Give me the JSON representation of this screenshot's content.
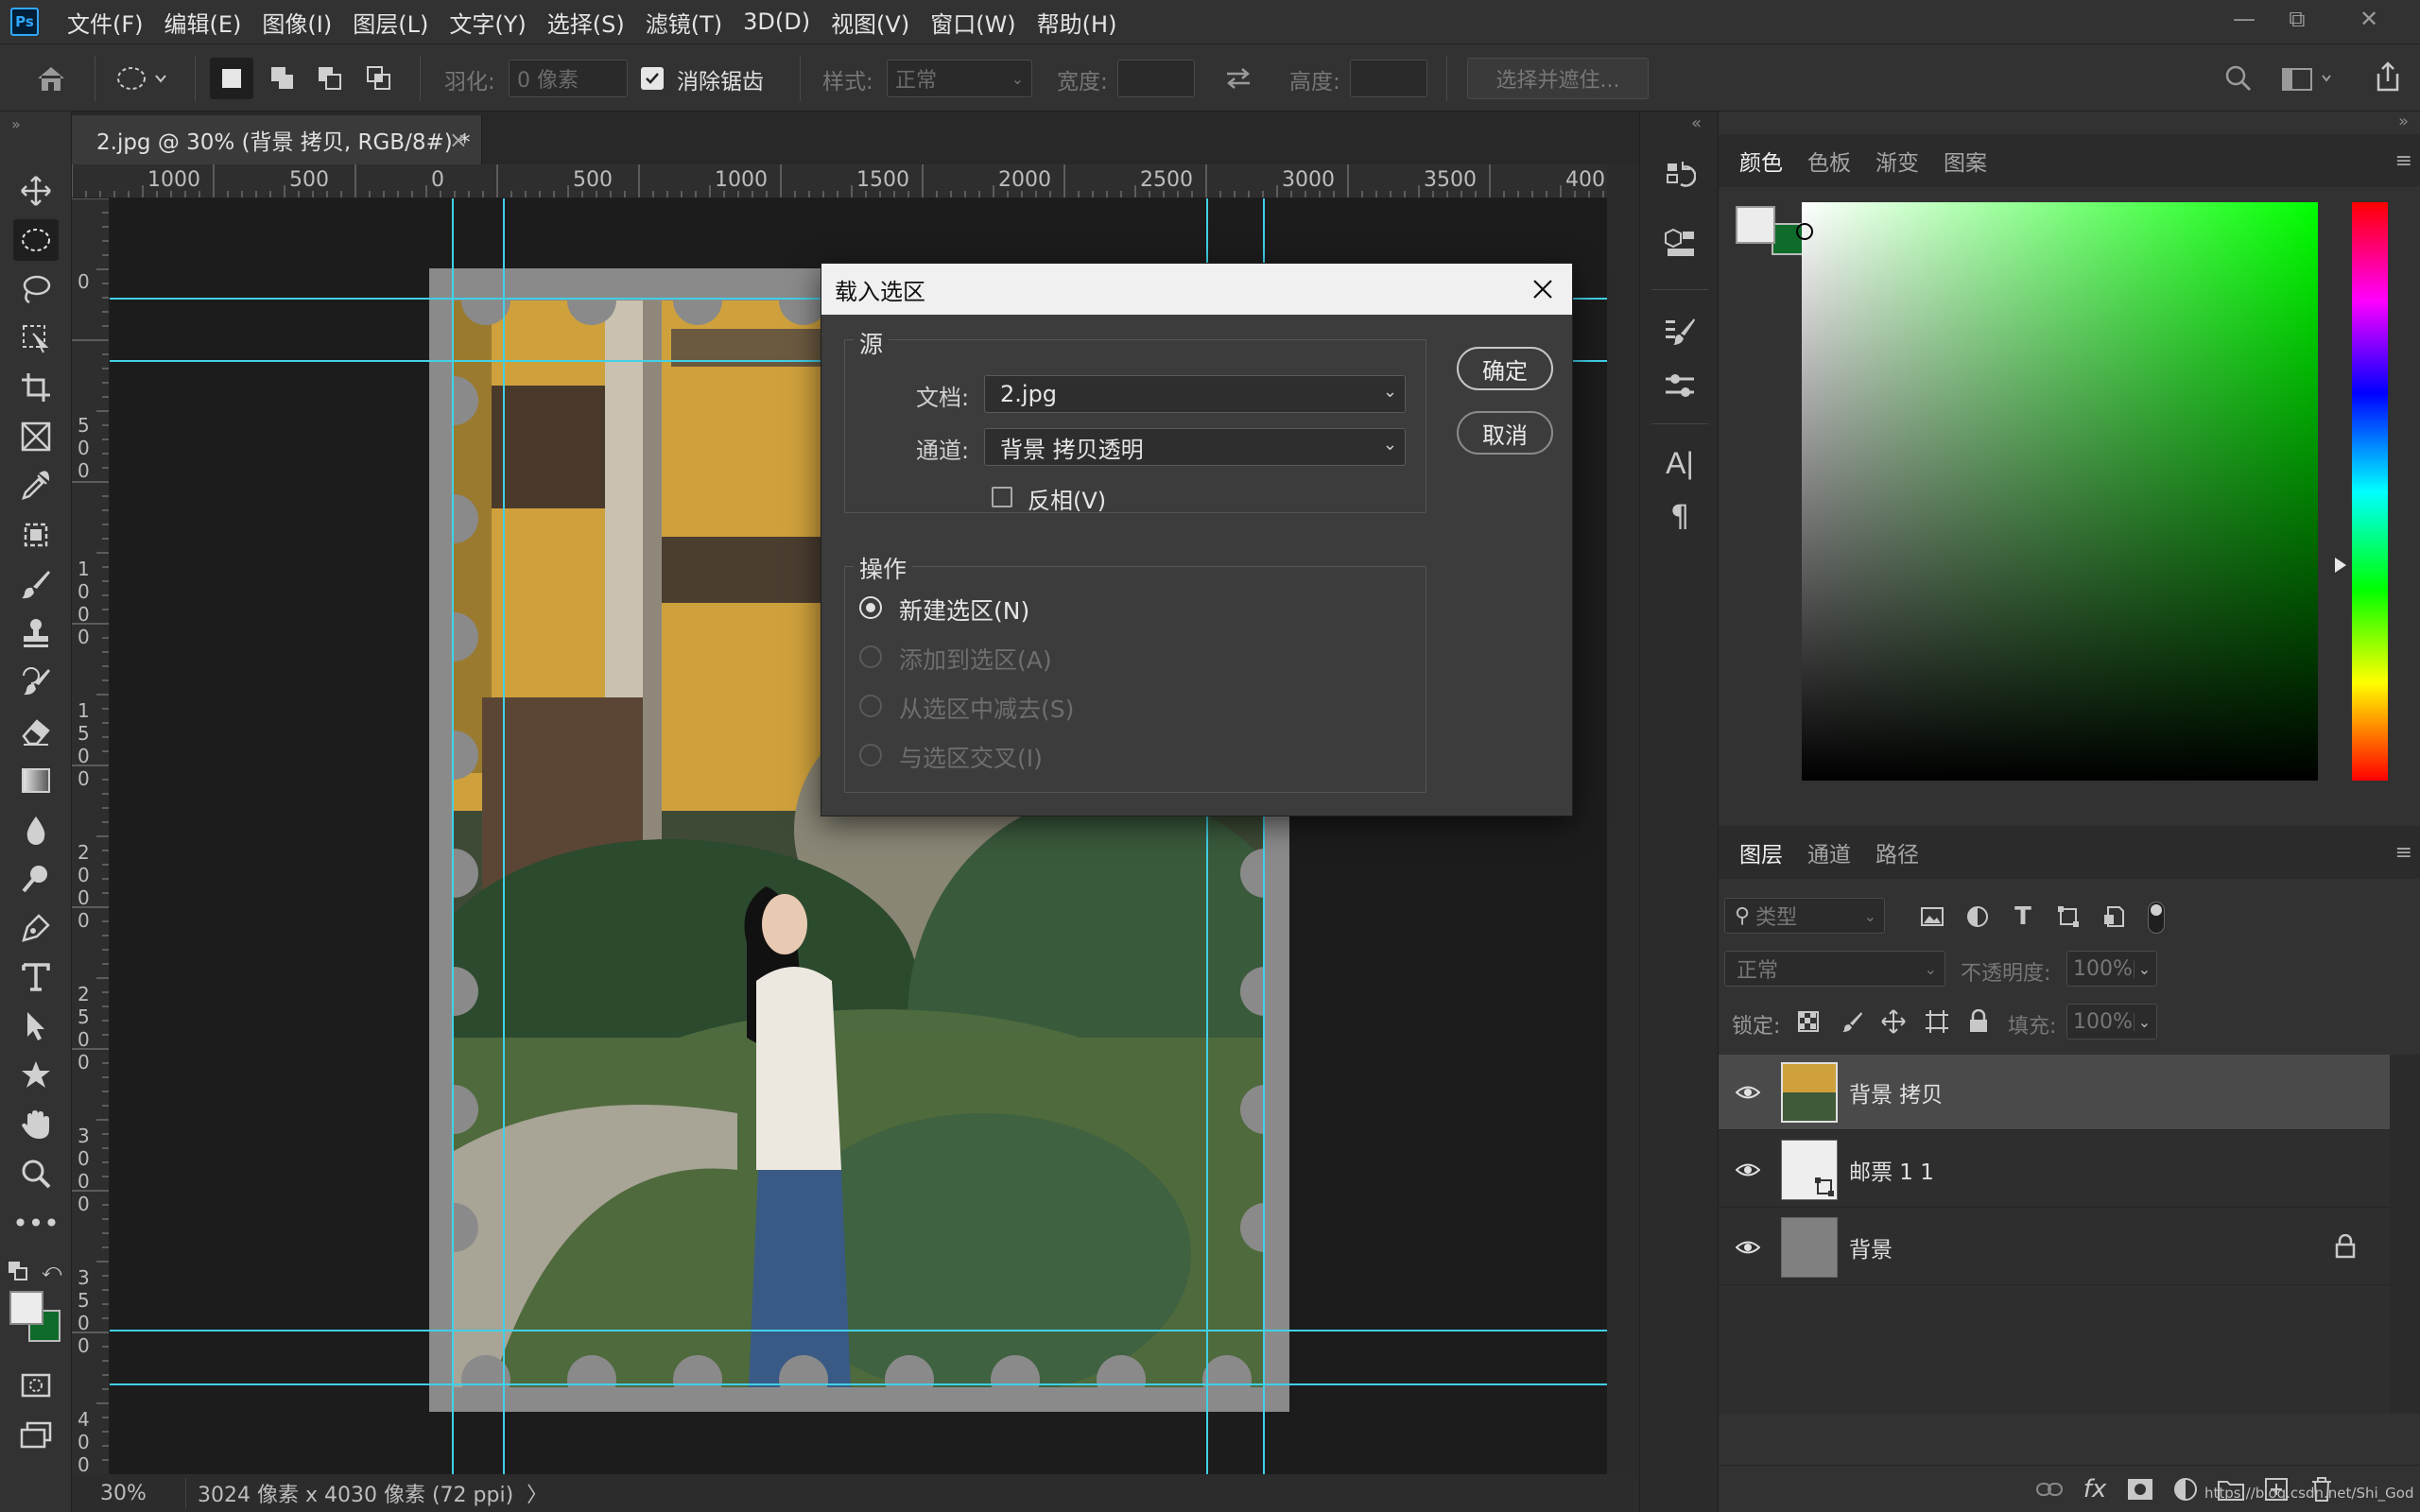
{
  "menubar": {
    "logo": "Ps",
    "items": [
      "文件(F)",
      "编辑(E)",
      "图像(I)",
      "图层(L)",
      "文字(Y)",
      "选择(S)",
      "滤镜(T)",
      "3D(D)",
      "视图(V)",
      "窗口(W)",
      "帮助(H)"
    ],
    "window_controls": {
      "minimize": "—",
      "restore": "⧉",
      "close": "✕"
    }
  },
  "options": {
    "feather_label": "羽化:",
    "feather_value": "0 像素",
    "antialias_label": "消除锯齿",
    "antialias_checked": true,
    "style_label": "样式:",
    "style_value": "正常",
    "width_label": "宽度:",
    "height_label": "高度:",
    "select_mask_label": "选择并遮住..."
  },
  "document": {
    "tab_title": "2.jpg @ 30% (背景 拷贝, RGB/8#) *",
    "tab_close": "×",
    "zoom": "30%",
    "status": "3024 像素 x 4030 像素 (72 ppi)",
    "status_arrow": "〉"
  },
  "ruler": {
    "horizontal": [
      "1000",
      "500",
      "0",
      "500",
      "1000",
      "1500",
      "2000",
      "2500",
      "3000",
      "3500",
      "400"
    ],
    "vertical": [
      "0",
      "5\n0\n0",
      "1\n0\n0\n0",
      "1\n5\n0\n0",
      "2\n0\n0\n0",
      "2\n5\n0\n0",
      "3\n0\n0\n0",
      "3\n5\n0\n0",
      "4\n0\n0"
    ]
  },
  "dialog": {
    "title": "载入选区",
    "source_legend": "源",
    "document_label": "文档:",
    "document_value": "2.jpg",
    "channel_label": "通道:",
    "channel_value": "背景 拷贝透明",
    "invert_label": "反相(V)",
    "invert_checked": false,
    "ok_label": "确定",
    "cancel_label": "取消",
    "operation_legend": "操作",
    "operations": [
      {
        "label": "新建选区(N)",
        "selected": true,
        "enabled": true
      },
      {
        "label": "添加到选区(A)",
        "selected": false,
        "enabled": false
      },
      {
        "label": "从选区中减去(S)",
        "selected": false,
        "enabled": false
      },
      {
        "label": "与选区交叉(I)",
        "selected": false,
        "enabled": false
      }
    ]
  },
  "color_panel": {
    "tabs": [
      "颜色",
      "色板",
      "渐变",
      "图案"
    ],
    "foreground": "#ececec",
    "background": "#0f6b2a",
    "hue_color": "#00ff00"
  },
  "layers_panel": {
    "tabs": [
      "图层",
      "通道",
      "路径"
    ],
    "filter_placeholder": "类型",
    "blend_mode": "正常",
    "opacity_label": "不透明度:",
    "opacity_value": "100%",
    "lock_label": "锁定:",
    "fill_label": "填充:",
    "fill_value": "100%",
    "layers": [
      {
        "name": "背景 拷贝",
        "selected": true
      },
      {
        "name": "邮票 1 1",
        "selected": false
      },
      {
        "name": "背景",
        "selected": false,
        "locked": true
      }
    ],
    "watermark": "https://blog.csdn.net/Shi_God"
  }
}
